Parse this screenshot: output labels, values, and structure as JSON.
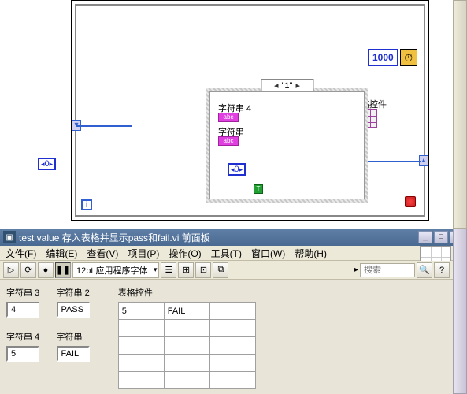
{
  "diagram": {
    "timer_ms": "1000",
    "case_value": "\"1\"",
    "str_label_4": "字符串 4",
    "str_label": "字符串",
    "abc_text": "abc",
    "table_ctrl_label": "表格控件",
    "zero_ctrl": "0",
    "zero_ctrl_2": "0",
    "bool_t": "T",
    "loop_i": "i"
  },
  "window": {
    "title": "test value 存入表格并显示pass和fail.vi 前面板"
  },
  "menu": {
    "file": "文件(F)",
    "edit": "编辑(E)",
    "view": "查看(V)",
    "project": "项目(P)",
    "operate": "操作(O)",
    "tools": "工具(T)",
    "window": "窗口(W)",
    "help": "帮助(H)"
  },
  "toolbar": {
    "font": "12pt 应用程序字体",
    "search_placeholder": "搜索",
    "search_icon": "🔍",
    "help_icon": "?"
  },
  "front_panel": {
    "str3_label": "字符串 3",
    "str3_value": "4",
    "str2_label": "字符串 2",
    "str2_value": "PASS",
    "str4_label": "字符串 4",
    "str4_value": "5",
    "str_label": "字符串",
    "str_value": "FAIL",
    "table_label": "表格控件",
    "table": [
      [
        "5",
        "FAIL",
        ""
      ],
      [
        "",
        "",
        ""
      ],
      [
        "",
        "",
        ""
      ],
      [
        "",
        "",
        ""
      ],
      [
        "",
        "",
        ""
      ]
    ]
  }
}
